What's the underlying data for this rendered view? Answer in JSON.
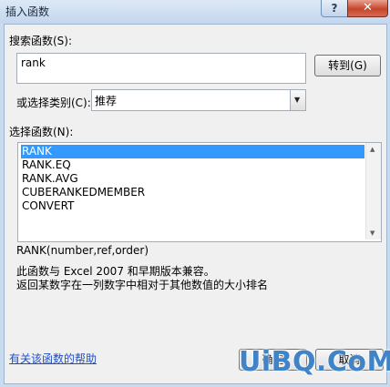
{
  "dialog": {
    "title": "插入函数",
    "help_glyph": "?",
    "close_glyph": "✕"
  },
  "search": {
    "label": "搜索函数(S):",
    "value": "rank",
    "go_button": "转到(G)"
  },
  "category": {
    "label": "或选择类别(C):",
    "selected": "推荐"
  },
  "functions": {
    "label": "选择函数(N):",
    "items": [
      "RANK",
      "RANK.EQ",
      "RANK.AVG",
      "CUBERANKEDMEMBER",
      "CONVERT"
    ],
    "selected_index": 0
  },
  "description": {
    "signature": "RANK(number,ref,order)",
    "line1": "此函数与 Excel 2007 和早期版本兼容。",
    "line2": "返回某数字在一列数字中相对于其他数值的大小排名"
  },
  "footer": {
    "help_link": "有关该函数的帮助",
    "ok_button": "确定",
    "cancel_button": "取消"
  },
  "watermark": "UiBQ.CoM"
}
